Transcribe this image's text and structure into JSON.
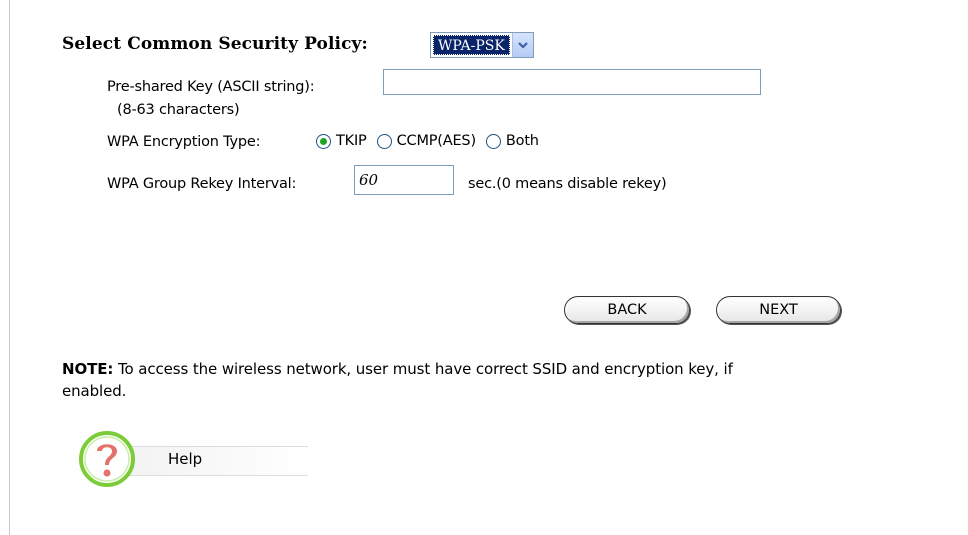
{
  "security": {
    "policy_label": "Select Common Security Policy:",
    "policy_value": "WPA-PSK",
    "psk_label": "Pre-shared Key (ASCII string):",
    "psk_hint": "(8-63 characters)",
    "psk_value": "",
    "encryption_label": "WPA Encryption Type:",
    "encryption_options": [
      {
        "label": "TKIP",
        "checked": true
      },
      {
        "label": "CCMP(AES)",
        "checked": false
      },
      {
        "label": "Both",
        "checked": false
      }
    ],
    "rekey_label": "WPA Group Rekey Interval:",
    "rekey_value": "60",
    "rekey_suffix": "sec.(0 means disable rekey)"
  },
  "nav": {
    "back_label": "BACK",
    "next_label": "NEXT"
  },
  "note": {
    "bold": "NOTE:",
    "text": " To access the wireless network, user must have correct SSID and encryption key, if enabled."
  },
  "help": {
    "label": "Help",
    "icon": "question-mark-icon"
  },
  "colors": {
    "select_highlight": "#0a246a",
    "radio_checked": "#21a121",
    "help_ring": "#7ccc3a",
    "help_glyph": "#e2726a"
  }
}
